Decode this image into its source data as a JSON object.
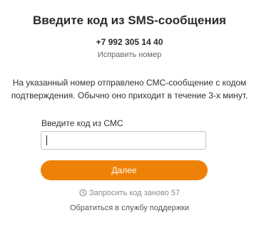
{
  "header": {
    "title": "Введите код из SMS-сообщения",
    "phone": "+7 992 305 14 40",
    "change_number_label": "Исправить номер"
  },
  "main": {
    "info_line1": "На указанный номер отправлено СМС-сообщение с кодом",
    "info_line2": "подтверждения. Обычно оно приходит в течение 3-х минут.",
    "code_field": {
      "label": "Введите код из СМС",
      "value": "",
      "placeholder": ""
    },
    "submit_label": "Далее",
    "resend": {
      "label": "Запросить код заново",
      "countdown": "57",
      "icon": "timer-icon"
    },
    "support_label": "Обратиться в службу поддержки"
  },
  "colors": {
    "accent": "#ee8208",
    "text": "#333333",
    "muted": "#8a8a8a"
  }
}
